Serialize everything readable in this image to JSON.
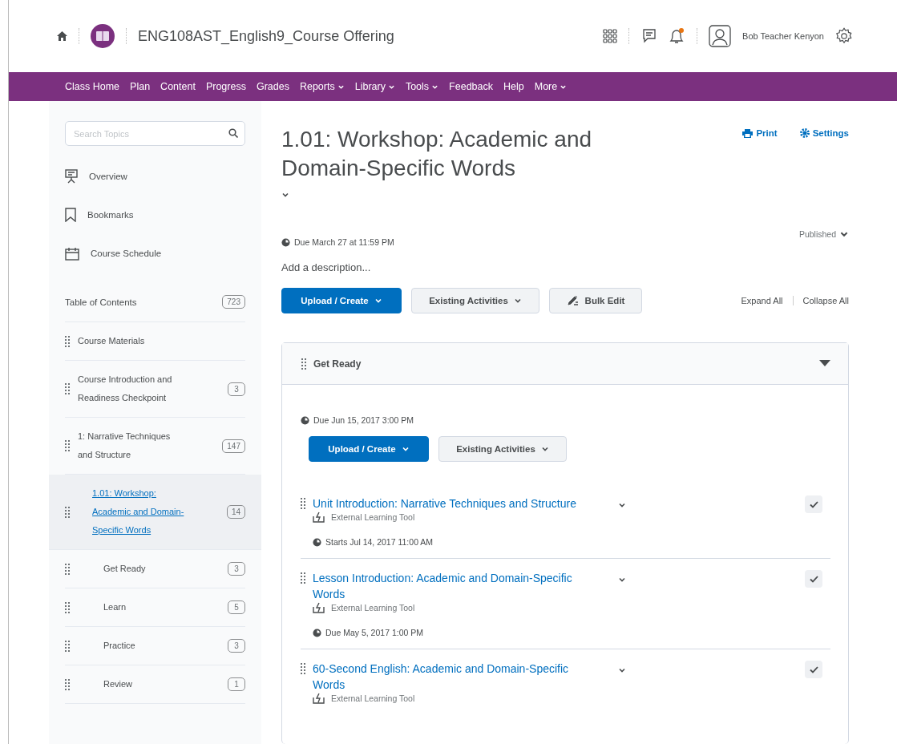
{
  "header": {
    "course_title": "ENG108AST_English9_Course Offering",
    "notifications_unread": true,
    "user_name": "Bob Teacher Kenyon"
  },
  "nav": [
    {
      "label": "Class Home",
      "dropdown": false
    },
    {
      "label": "Plan",
      "dropdown": false
    },
    {
      "label": "Content",
      "dropdown": false
    },
    {
      "label": "Progress",
      "dropdown": false
    },
    {
      "label": "Grades",
      "dropdown": false
    },
    {
      "label": "Reports",
      "dropdown": true
    },
    {
      "label": "Library",
      "dropdown": true
    },
    {
      "label": "Tools",
      "dropdown": true
    },
    {
      "label": "Feedback",
      "dropdown": false
    },
    {
      "label": "Help",
      "dropdown": false
    },
    {
      "label": "More",
      "dropdown": true
    }
  ],
  "sidebar": {
    "search": {
      "placeholder": "Search Topics"
    },
    "links": [
      {
        "label": "Overview",
        "kind": "overview"
      },
      {
        "label": "Bookmarks",
        "kind": "bookmark"
      },
      {
        "label": "Course Schedule",
        "kind": "calendar"
      }
    ],
    "toc": {
      "label": "Table of Contents",
      "count": "723",
      "modules": [
        {
          "label": "Course Materials",
          "selected": false
        },
        {
          "label": "Course Introduction and Readiness Checkpoint",
          "count": "3",
          "selected": false
        },
        {
          "label": "1: Narrative Techniques and Structure",
          "count": "147",
          "selected": false,
          "children": [
            {
              "label": "1.01: Workshop: Academic and Domain-Specific Words",
              "count": "14",
              "selected": true,
              "children": [
                {
                  "label": "Get Ready",
                  "count": "3",
                  "selected": false
                },
                {
                  "label": "Learn",
                  "count": "5",
                  "selected": false
                },
                {
                  "label": "Practice",
                  "count": "3",
                  "selected": false
                },
                {
                  "label": "Review",
                  "count": "1",
                  "selected": false
                }
              ]
            }
          ]
        }
      ]
    }
  },
  "main": {
    "title": "1.01: Workshop: Academic and Domain-Specific Words",
    "actions": [
      {
        "label": "Print",
        "kind": "print"
      },
      {
        "label": "Settings",
        "kind": "settings"
      }
    ],
    "due": "Due March 27 at 11:59 PM",
    "status": "Published",
    "description": {
      "placeholder": "Add a description..."
    },
    "buttons": [
      {
        "label": "Upload / Create",
        "kind": "primary"
      },
      {
        "label": "Existing Activities",
        "kind": "dropdown"
      },
      {
        "label": "Bulk Edit",
        "kind": "edit"
      }
    ],
    "expand_all": "Expand All",
    "collapse_all": "Collapse All",
    "module": {
      "title": "Get Ready",
      "expanded": true,
      "due": "Due Jun 15, 2017 3:00 PM",
      "buttons": [
        {
          "label": "Upload / Create",
          "kind": "primary"
        },
        {
          "label": "Existing Activities",
          "kind": "dropdown"
        }
      ],
      "items": [
        {
          "title": "Unit Introduction: Narrative Techniques and Structure",
          "type": "External Learning Tool",
          "date": "Starts Jul 14, 2017 11:00 AM",
          "visible": true
        },
        {
          "title": "Lesson Introduction: Academic and Domain-Specific Words",
          "type": "External Learning Tool",
          "date": "Due May 5, 2017 1:00 PM",
          "visible": true
        },
        {
          "title": "60-Second English: Academic and Domain-Specific Words",
          "type": "External Learning Tool",
          "visible": true
        }
      ]
    }
  }
}
